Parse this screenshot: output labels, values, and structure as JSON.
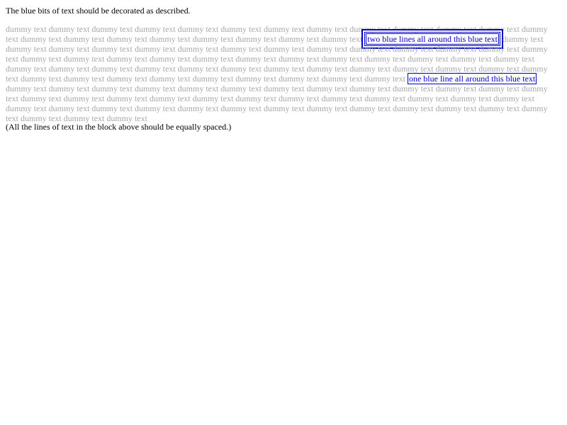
{
  "intro": "The blue bits of text should be decorated as described.",
  "block": {
    "filler_before_double": "dummy text dummy text dummy text dummy text dummy text dummy text dummy text dummy text dummy text dummy text dummy text dummy text dummy text dummy text dummy text dummy text dummy text dummy text dummy text dummy text dummy text",
    "double_outline_text": "two blue lines all around this blue text",
    "filler_between": "dummy text dummy text dummy text dummy text dummy text dummy text dummy text dummy text dummy text dummy text dummy text dummy text dummy text dummy text dummy text dummy text dummy text dummy text dummy text dummy text dummy text dummy text dummy text dummy text dummy text dummy text dummy text dummy text dummy text dummy text dummy text dummy text dummy text dummy text dummy text dummy text dummy text dummy text dummy text dummy text dummy text dummy text dummy text dummy text dummy text dummy text dummy text dummy text",
    "single_outline_text": "one blue line all around this blue text",
    "filler_after": "dummy text dummy text dummy text dummy text dummy text dummy text dummy text dummy text dummy text dummy text dummy text dummy text dummy text dummy text dummy text dummy text dummy text dummy text dummy text dummy text dummy text dummy text dummy text dummy text dummy text dummy text dummy text dummy text dummy text dummy text dummy text dummy text dummy text dummy text dummy text dummy text dummy text dummy text dummy text dummy text dummy text"
  },
  "outro": "(All the lines of text in the block above should be equally spaced.)",
  "colors": {
    "blue": "#0000c8",
    "filler": "#a7a7a7"
  }
}
